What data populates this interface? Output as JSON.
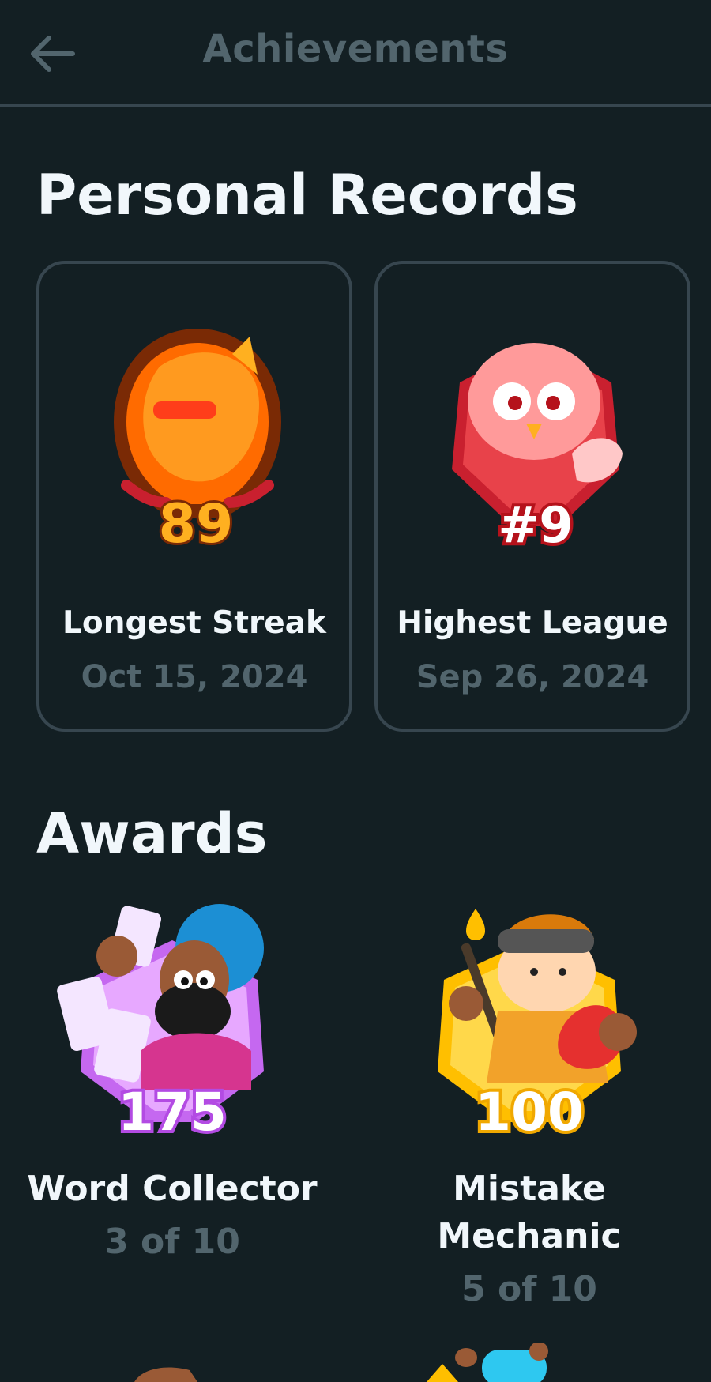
{
  "header": {
    "title": "Achievements",
    "back_icon": "arrow-left-icon"
  },
  "personal_records": {
    "title": "Personal Records",
    "items": [
      {
        "label": "Longest Streak",
        "date": "Oct 15, 2024",
        "badge_value": "89",
        "icon": "flame-duo-badge-icon",
        "colors": {
          "frame": "#7a2a05",
          "fill": "#ff6b00",
          "number": "#ffb020"
        }
      },
      {
        "label": "Highest League",
        "date": "Sep 26, 2024",
        "badge_value": "#9",
        "icon": "ruby-league-duo-badge-icon",
        "colors": {
          "frame": "#c9202f",
          "fill": "#ff6f70",
          "number": "#ffffff"
        }
      }
    ]
  },
  "awards": {
    "title": "Awards",
    "items": [
      {
        "label": "Word Collector",
        "progress": "3 of 10",
        "badge_value": "175",
        "icon": "word-collector-badge-icon",
        "colors": {
          "frame": "#c568f0",
          "fill": "#e7a8ff",
          "number": "#ffffff"
        }
      },
      {
        "label": "Mistake Mechanic",
        "progress": "5 of 10",
        "badge_value": "100",
        "icon": "mistake-mechanic-badge-icon",
        "colors": {
          "frame": "#ffbf00",
          "fill": "#ffd84a",
          "number": "#ffffff"
        }
      }
    ]
  }
}
